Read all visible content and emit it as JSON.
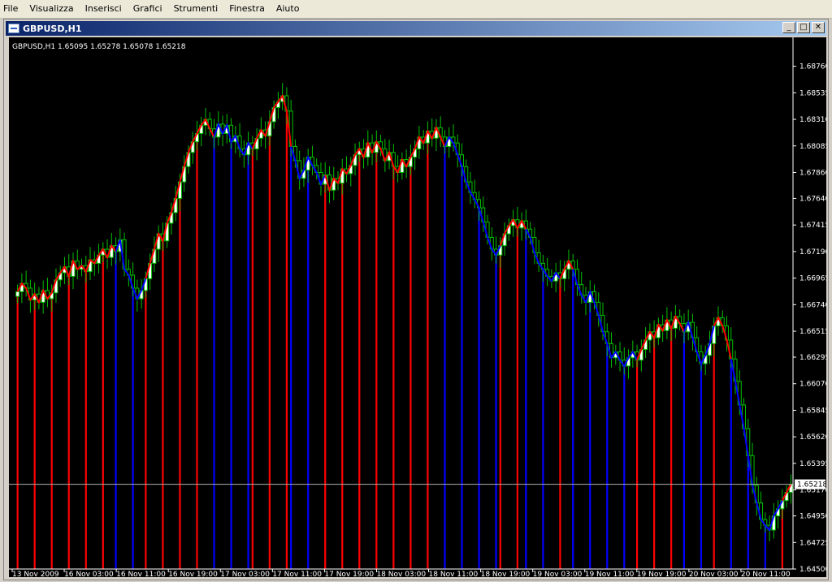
{
  "menu": [
    "File",
    "Visualizza",
    "Inserisci",
    "Grafici",
    "Strumenti",
    "Finestra",
    "Aiuto"
  ],
  "window": {
    "title": "GBPUSD,H1",
    "minimize": "_",
    "maximize": "□",
    "close": "✕"
  },
  "chart_data": {
    "type": "candlestick",
    "symbol_label": "GBPUSD,H1",
    "ohlc": "1.65095 1.65278 1.65078 1.65218",
    "current_price": 1.65218,
    "current_price_label": "1.65218",
    "ylim": [
      1.645,
      1.6895
    ],
    "y_ticks": [
      1.6876,
      1.68535,
      1.6831,
      1.68085,
      1.6786,
      1.6764,
      1.67415,
      1.6719,
      1.66965,
      1.6674,
      1.66515,
      1.66295,
      1.6607,
      1.65845,
      1.6562,
      1.65395,
      1.6517,
      1.6495,
      1.64725,
      1.645
    ],
    "x_ticks": [
      "13 Nov 2009",
      "16 Nov 03:00",
      "16 Nov 11:00",
      "16 Nov 19:00",
      "17 Nov 03:00",
      "17 Nov 11:00",
      "17 Nov 19:00",
      "18 Nov 03:00",
      "18 Nov 11:00",
      "18 Nov 19:00",
      "19 Nov 03:00",
      "19 Nov 11:00",
      "19 Nov 19:00",
      "20 Nov 03:00",
      "20 Nov 11:00"
    ],
    "colors": {
      "background": "#000000",
      "axis": "#ffffff",
      "bull_fill": "#ffffff",
      "bear_fill": "#000000",
      "candle_outline": "#00c000",
      "trend_up": "#ff0000",
      "trend_down": "#0000ff",
      "price_line": "#b0b0b0"
    },
    "close": [
      1.6685,
      1.6692,
      1.6688,
      1.6678,
      1.6683,
      1.6676,
      1.6686,
      1.6679,
      1.6684,
      1.6695,
      1.6701,
      1.6706,
      1.6698,
      1.6711,
      1.6704,
      1.6707,
      1.6702,
      1.6712,
      1.6709,
      1.6716,
      1.6721,
      1.6714,
      1.6724,
      1.6719,
      1.6729,
      1.6704,
      1.6699,
      1.6688,
      1.6679,
      1.6686,
      1.6696,
      1.6709,
      1.6721,
      1.6734,
      1.6728,
      1.6743,
      1.6752,
      1.6764,
      1.6778,
      1.6791,
      1.6803,
      1.6812,
      1.6819,
      1.6826,
      1.6831,
      1.6823,
      1.6816,
      1.6827,
      1.6819,
      1.6826,
      1.6812,
      1.6817,
      1.6806,
      1.6801,
      1.6811,
      1.6806,
      1.6815,
      1.6822,
      1.6817,
      1.6829,
      1.6841,
      1.6846,
      1.6851,
      1.6838,
      1.6808,
      1.6796,
      1.6781,
      1.6788,
      1.6799,
      1.6792,
      1.6786,
      1.6776,
      1.6784,
      1.6771,
      1.6781,
      1.6777,
      1.6789,
      1.6785,
      1.6792,
      1.6801,
      1.6806,
      1.6799,
      1.6811,
      1.6803,
      1.6812,
      1.6806,
      1.6796,
      1.6803,
      1.6791,
      1.6786,
      1.6797,
      1.6791,
      1.6799,
      1.6806,
      1.6816,
      1.6811,
      1.6821,
      1.6815,
      1.6824,
      1.6816,
      1.6808,
      1.6816,
      1.6811,
      1.6801,
      1.6791,
      1.6778,
      1.6769,
      1.6763,
      1.6756,
      1.6744,
      1.6731,
      1.6721,
      1.6716,
      1.6724,
      1.6734,
      1.6741,
      1.6746,
      1.6739,
      1.6745,
      1.6738,
      1.6731,
      1.6718,
      1.6709,
      1.6704,
      1.6698,
      1.6694,
      1.6701,
      1.6696,
      1.6704,
      1.6711,
      1.6704,
      1.6691,
      1.6682,
      1.6676,
      1.6685,
      1.6676,
      1.6665,
      1.6651,
      1.6641,
      1.6629,
      1.6634,
      1.6627,
      1.6622,
      1.6629,
      1.6634,
      1.6627,
      1.6636,
      1.6644,
      1.6651,
      1.6646,
      1.6657,
      1.6652,
      1.6661,
      1.6654,
      1.6664,
      1.6658,
      1.6651,
      1.6659,
      1.6646,
      1.6634,
      1.6624,
      1.6631,
      1.6641,
      1.6656,
      1.6663,
      1.6656,
      1.6644,
      1.6628,
      1.6609,
      1.6589,
      1.6569,
      1.6546,
      1.6521,
      1.6506,
      1.6492,
      1.6487,
      1.6483,
      1.6495,
      1.6501,
      1.6508,
      1.6515,
      1.65218
    ],
    "trend_flips": [
      {
        "direction": "up",
        "start": 0,
        "end": 22
      },
      {
        "direction": "down",
        "start": 23,
        "end": 29
      },
      {
        "direction": "up",
        "start": 30,
        "end": 45
      },
      {
        "direction": "down",
        "start": 46,
        "end": 54
      },
      {
        "direction": "up",
        "start": 55,
        "end": 63
      },
      {
        "direction": "down",
        "start": 64,
        "end": 71
      },
      {
        "direction": "up",
        "start": 72,
        "end": 99
      },
      {
        "direction": "down",
        "start": 100,
        "end": 112
      },
      {
        "direction": "up",
        "start": 113,
        "end": 118
      },
      {
        "direction": "down",
        "start": 119,
        "end": 126
      },
      {
        "direction": "up",
        "start": 127,
        "end": 129
      },
      {
        "direction": "down",
        "start": 130,
        "end": 144
      },
      {
        "direction": "up",
        "start": 145,
        "end": 155
      },
      {
        "direction": "down",
        "start": 156,
        "end": 162
      },
      {
        "direction": "up",
        "start": 163,
        "end": 166
      },
      {
        "direction": "down",
        "start": 167,
        "end": 178
      },
      {
        "direction": "up",
        "start": 179,
        "end": 183
      }
    ]
  }
}
